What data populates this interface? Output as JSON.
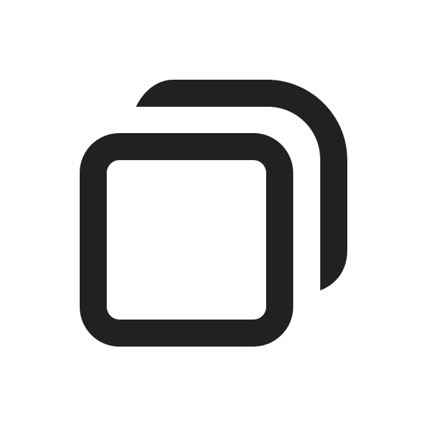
{
  "icon": {
    "name": "copy-icon",
    "color": "#212121",
    "background": "#ffffff"
  }
}
